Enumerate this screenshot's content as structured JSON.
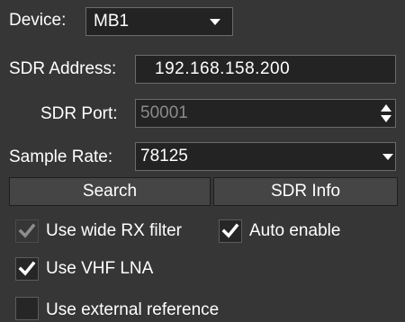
{
  "device": {
    "label": "Device:",
    "value": "MB1"
  },
  "sdr_address": {
    "label": "SDR Address:",
    "value": "192.168.158.200"
  },
  "sdr_port": {
    "label": "SDR Port:",
    "value": "50001"
  },
  "sample_rate": {
    "label": "Sample Rate:",
    "value": "78125"
  },
  "buttons": {
    "search": "Search",
    "sdr_info": "SDR Info"
  },
  "checkboxes": {
    "wide_rx_filter": {
      "label": "Use wide RX filter",
      "checked": true,
      "enabled": false
    },
    "auto_enable": {
      "label": "Auto enable",
      "checked": true,
      "enabled": true
    },
    "vhf_lna": {
      "label": "Use VHF LNA",
      "checked": true,
      "enabled": true
    },
    "external_reference": {
      "label": "Use external reference",
      "checked": false,
      "enabled": true
    }
  },
  "colors": {
    "background": "#363636",
    "field_background": "#232323",
    "button_background": "#454545",
    "disabled_text": "#8a8a8a",
    "check_mark": "#ffffff",
    "check_mark_disabled": "#8d8d8d"
  },
  "icons": {
    "dropdown": "chevron-down-icon",
    "spin_up": "triangle-up-icon",
    "spin_down": "triangle-down-icon",
    "check": "check-icon"
  }
}
